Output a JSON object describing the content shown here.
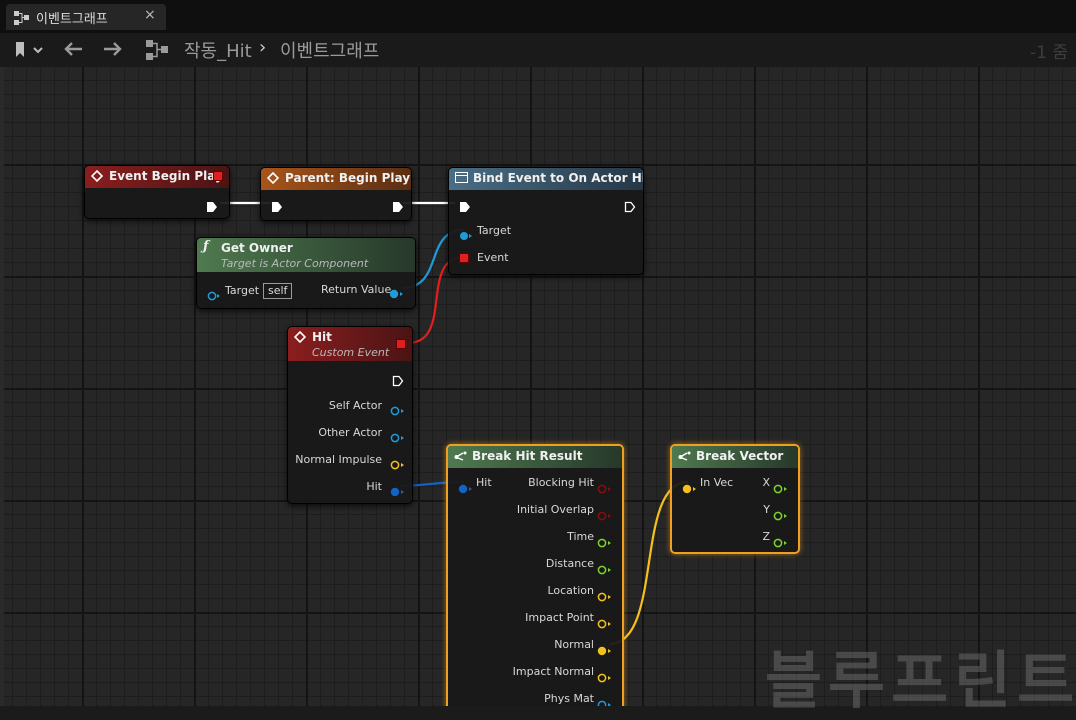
{
  "tab": {
    "label": "이벤트그래프",
    "close": "×"
  },
  "breadcrumb": {
    "parent": "작동_Hit",
    "separator": "›",
    "current": "이벤트그래프"
  },
  "zoom_label": "-1 줌",
  "watermark": "블루프린트",
  "colors": {
    "exec": "#ffffff",
    "event_header": "#8b1e1e",
    "parent_header": "#a8551a",
    "function_header": "#4a6e86",
    "pure_header": "#4f7a4f",
    "object_pin": "#1e9bd8",
    "struct_hit_pin": "#1263c7",
    "vector_pin": "#f4c01c",
    "float_pin": "#7bd42b",
    "bool_pin": "#8a0d0d",
    "delegate_pin": "#e02020",
    "selection": "#f0a020"
  },
  "nodes": {
    "event_begin_play": {
      "title": "Event Begin Play"
    },
    "parent_begin_play": {
      "title": "Parent: Begin Play"
    },
    "bind_event": {
      "title": "Bind Event to On Actor Hit",
      "pins": {
        "target": "Target",
        "event": "Event"
      }
    },
    "get_owner": {
      "title": "Get Owner",
      "subtitle": "Target is Actor Component",
      "pins": {
        "target": "Target",
        "target_default": "self",
        "return_value": "Return Value"
      }
    },
    "hit_event": {
      "title": "Hit",
      "subtitle": "Custom Event",
      "pins": {
        "self_actor": "Self Actor",
        "other_actor": "Other Actor",
        "normal_impulse": "Normal Impulse",
        "hit": "Hit"
      }
    },
    "break_hit_result": {
      "title": "Break Hit Result",
      "pins": {
        "hit": "Hit",
        "blocking_hit": "Blocking Hit",
        "initial_overlap": "Initial Overlap",
        "time": "Time",
        "distance": "Distance",
        "location": "Location",
        "impact_point": "Impact Point",
        "normal": "Normal",
        "impact_normal": "Impact Normal",
        "phys_mat": "Phys Mat"
      }
    },
    "break_vector": {
      "title": "Break Vector",
      "pins": {
        "in_vec": "In Vec",
        "x": "X",
        "y": "Y",
        "z": "Z"
      }
    }
  }
}
